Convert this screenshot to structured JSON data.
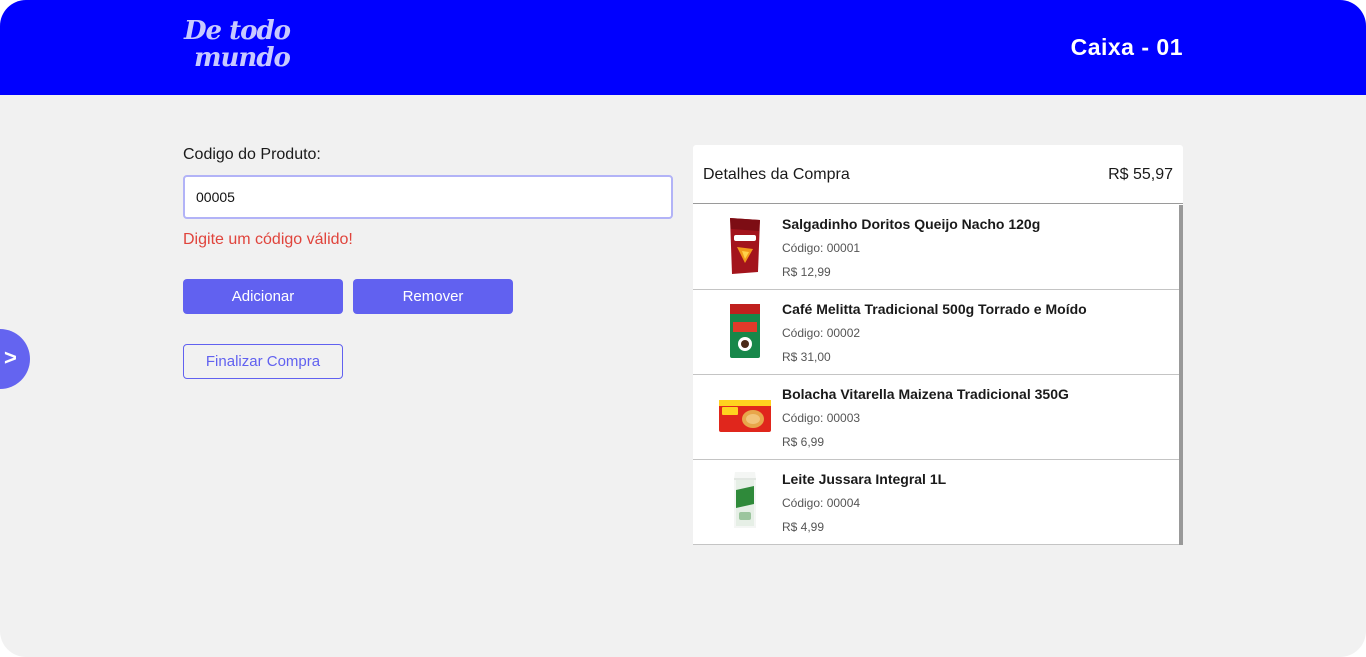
{
  "header": {
    "logo_line1": "De todo",
    "logo_line2": "mundo",
    "title": "Caixa - 01"
  },
  "form": {
    "code_label": "Codigo do Produto:",
    "code_value": "00005",
    "error_message": "Digite um código válido!",
    "add_label": "Adicionar",
    "remove_label": "Remover",
    "finish_label": "Finalizar Compra"
  },
  "sidebar_toggle": {
    "label": ">"
  },
  "purchase": {
    "title": "Detalhes da Compra",
    "total": "R$ 55,97",
    "items": [
      {
        "name": "Salgadinho Doritos Queijo Nacho 120g",
        "code": "Código: 00001",
        "price": "R$ 12,99",
        "image": "doritos-package"
      },
      {
        "name": "Café Melitta Tradicional 500g Torrado e Moído",
        "code": "Código: 00002",
        "price": "R$ 31,00",
        "image": "melitta-coffee-package"
      },
      {
        "name": "Bolacha Vitarella Maizena Tradicional 350G",
        "code": "Código: 00003",
        "price": "R$ 6,99",
        "image": "vitarella-cookie-package"
      },
      {
        "name": "Leite Jussara Integral 1L",
        "code": "Código: 00004",
        "price": "R$ 4,99",
        "image": "jussara-milk-carton"
      }
    ]
  },
  "colors": {
    "header": "#0000ff",
    "accent": "#6161f0",
    "error": "#e0443c",
    "background": "#f1f1f1"
  }
}
